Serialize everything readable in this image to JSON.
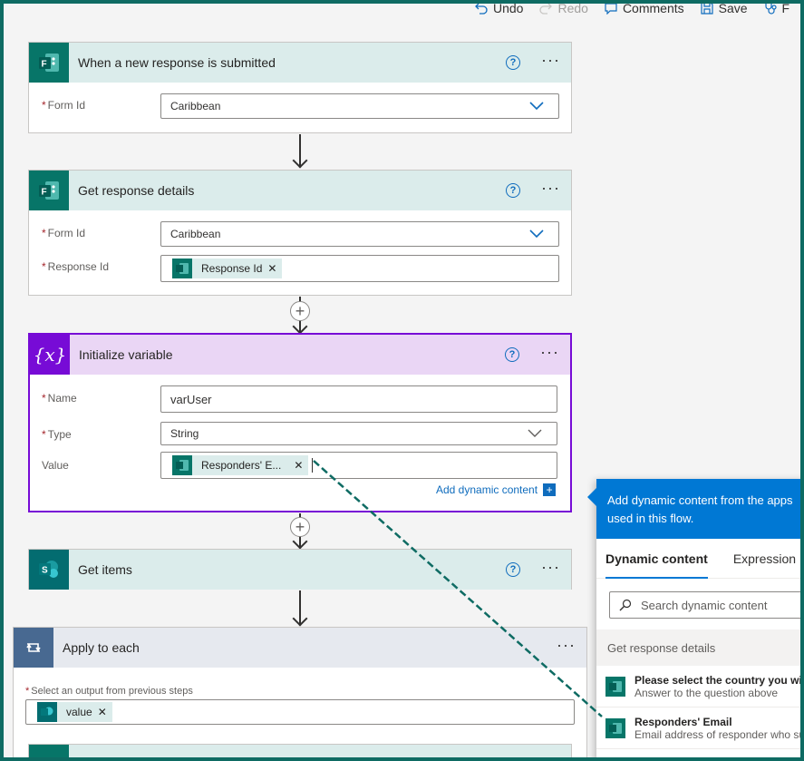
{
  "toolbar": {
    "undo": "Undo",
    "redo": "Redo",
    "comments": "Comments",
    "save": "Save",
    "flow_checker": "F"
  },
  "trigger": {
    "title": "When a new response is submitted",
    "form_id_label": "Form Id",
    "form_id_value": "Caribbean"
  },
  "get_response": {
    "title": "Get response details",
    "form_id_label": "Form Id",
    "form_id_value": "Caribbean",
    "response_id_label": "Response Id",
    "response_id_token": "Response Id"
  },
  "init_var": {
    "title": "Initialize variable",
    "name_label": "Name",
    "name_value": "varUser",
    "type_label": "Type",
    "type_value": "String",
    "value_label": "Value",
    "value_token": "Responders' E...",
    "add_dynamic": "Add dynamic content",
    "logo_text": "{x}"
  },
  "get_items": {
    "title": "Get items"
  },
  "apply_each": {
    "title": "Apply to each",
    "select_label": "Select an output from previous steps",
    "value_token": "value"
  },
  "panel": {
    "header": "Add dynamic content from the apps used in this flow.",
    "tabs": [
      "Dynamic content",
      "Expression"
    ],
    "search_placeholder": "Search dynamic content",
    "section": "Get response details",
    "items": [
      {
        "name": "Please select the country you will",
        "desc": "Answer to the question above"
      },
      {
        "name": "Responders' Email",
        "desc": "Email address of responder who su"
      }
    ]
  },
  "colors": {
    "forms": "#077568",
    "variable": "#770bd6",
    "sharepoint": "#036c70",
    "apply": "#486991",
    "accent": "#0078d4"
  }
}
